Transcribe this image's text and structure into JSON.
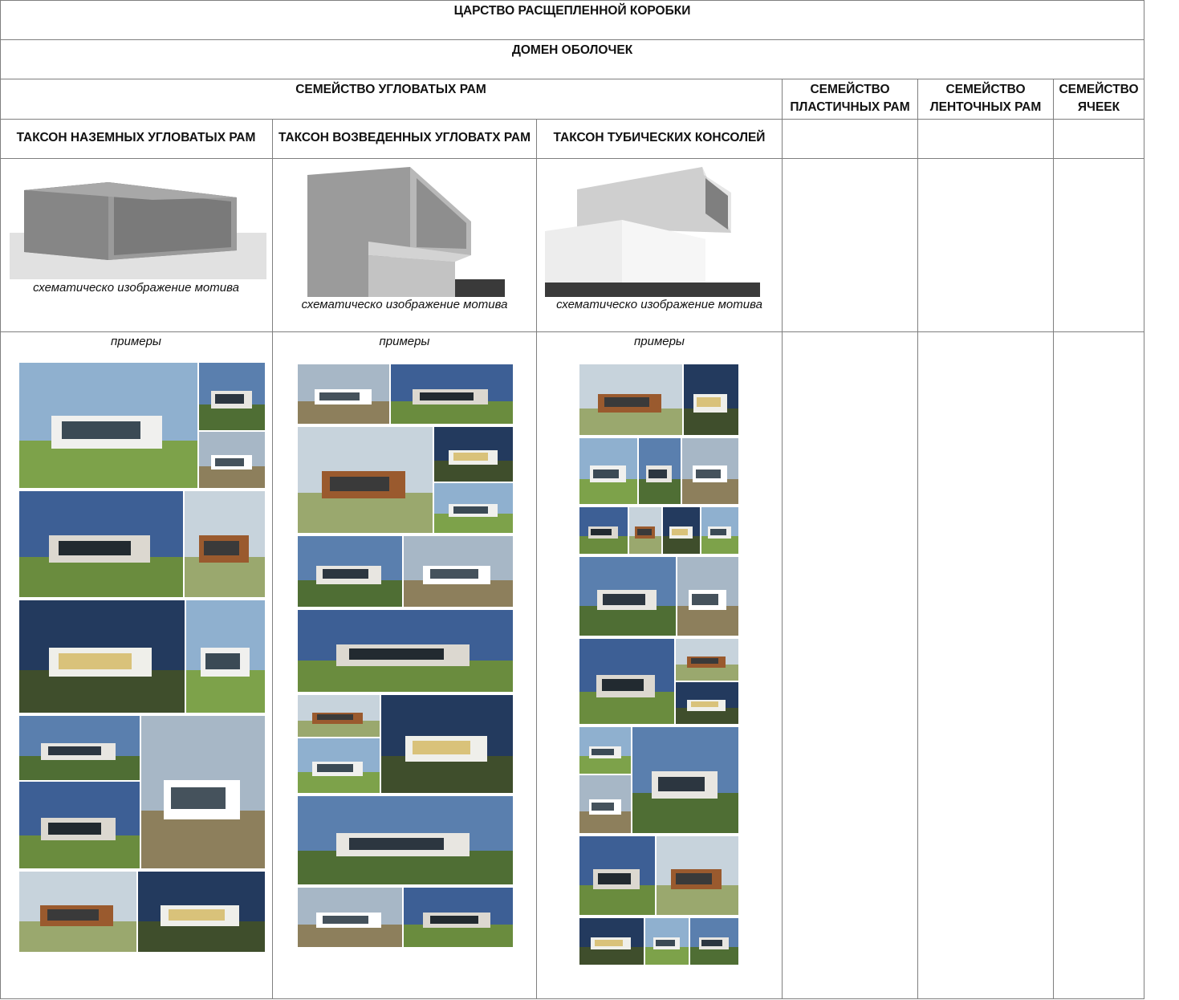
{
  "kingdom": "ЦАРСТВО РАСЩЕПЛЕННОЙ КОРОБКИ",
  "domain": "ДОМЕН ОБОЛОЧЕК",
  "families": {
    "angular": "СЕМЕЙСТВО УГЛОВАТЫХ РАМ",
    "plastic": "СЕМЕЙСТВО ПЛАСТИЧНЫХ РАМ",
    "ribbon": "СЕМЕЙСТВО ЛЕНТОЧНЫХ РАМ",
    "cells": "СЕМЕЙСТВО ЯЧЕЕК"
  },
  "taxa": [
    {
      "title": "ТАКСОН НАЗЕМНЫХ УГЛОВАТЫХ РАМ",
      "caption": "схематическо изображение мотива",
      "examples_label": "примеры"
    },
    {
      "title": "ТАКСОН ВОЗВЕДЕННЫХ УГЛОВАТХ РАМ",
      "caption": "схематическо изображение мотива",
      "examples_label": "примеры"
    },
    {
      "title": "ТАКСОН ТУБИЧЕСКИХ КОНСОЛЕЙ",
      "caption": "схематическо изображение мотива",
      "examples_label": "примеры"
    }
  ],
  "colors": {
    "grid_line": "#7f7f7f",
    "sky": "#5f86b5",
    "grass": "#6f9a3c",
    "concrete": "#e9e9e6",
    "timber": "#9a5a2e"
  }
}
